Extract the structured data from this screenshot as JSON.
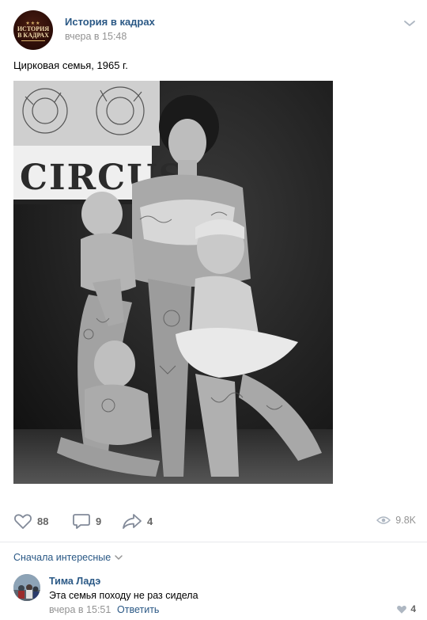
{
  "post": {
    "group_name": "История в кадрах",
    "avatar_text_line1": "ИСТОРИЯ",
    "avatar_text_line2": "В КАДРАХ",
    "time": "вчера в 15:48",
    "text": "Цирковая семья, 1965 г.",
    "photo_sign": "CIRCUS"
  },
  "actions": {
    "likes": "88",
    "comments": "9",
    "shares": "4",
    "views": "9.8K"
  },
  "comments_section": {
    "sort_label": "Сначала интересные",
    "items": [
      {
        "author": "Тима Ладэ",
        "text": "Эта семья походу не раз сидела",
        "time": "вчера в 15:51",
        "reply_label": "Ответить",
        "likes": "4"
      }
    ]
  },
  "colors": {
    "link": "#2a5885",
    "secondary_text": "#939393",
    "icon": "#828a99"
  }
}
